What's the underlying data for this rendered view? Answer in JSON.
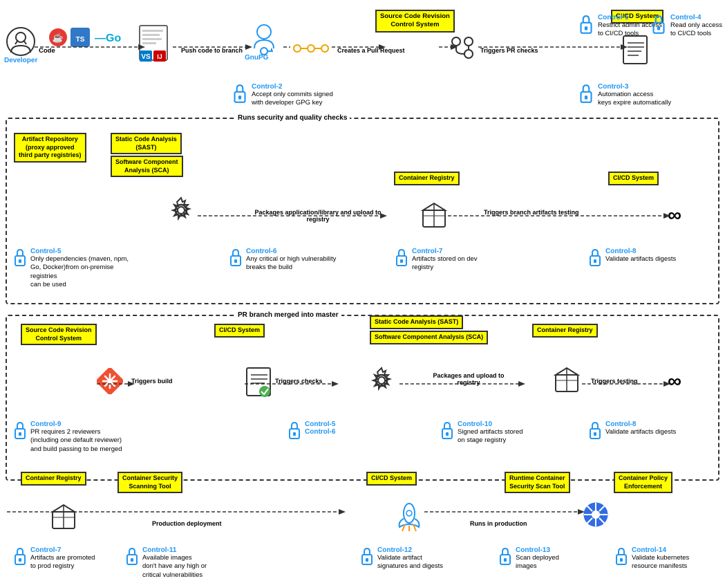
{
  "sections": {
    "section1_label": "Runs security and quality checks",
    "section2_label": "PR branch merged into master",
    "section3_label": ""
  },
  "row1": {
    "developer_label": "Developer",
    "flow1": "Code",
    "flow2": "Push code to branch",
    "flow3": "Creates a Pull Request",
    "flow4": "Triggers PR checks",
    "source_code_box": "Source Code Revision\nControl System",
    "cicd_box": "CI/CD System",
    "control1_title": "Control-1",
    "control1_text": "Restrict admin access\nto CI/CD tools",
    "control4_title": "Control-4",
    "control4_text": "Read only access\nto CI/CD tools",
    "control2_title": "Control-2",
    "control2_text": "Accept only commits signed\nwith developer GPG key",
    "control3_title": "Control-3",
    "control3_text": "Automation access\nkeys expire automatically"
  },
  "row2": {
    "artifact_repo_box": "Artifact Repository\n(proxy approved\nthird party registries)",
    "sast_box": "Static Code Analysis\n(SAST)",
    "sca_box": "Software Component\nAnalysis (SCA)",
    "container_registry_box": "Container Registry",
    "cicd_system_box": "CI/CD System",
    "flow1": "Packages application/library\nand upload to registry",
    "flow2": "Triggers branch artifacts testing",
    "control5_title": "Control-5",
    "control5_text": "Only dependencies (maven, npm,\nGo, Docker)from on-premise registries\ncan be used",
    "control6_title": "Control-6",
    "control6_text": "Any critical or high vulnerability\nbreaks the build",
    "control7_title": "Control-7",
    "control7_text": "Artifacts stored on dev\nregistry",
    "control8_title": "Control-8",
    "control8_text": "Validate artifacts digests"
  },
  "row3": {
    "source_code_box": "Source Code Revision\nControl System",
    "cicd_box": "CI/CD System",
    "sast_box": "Static Code Analysis\n(SAST)",
    "sca_box": "Software Component\nAnalysis (SCA)",
    "container_registry_box": "Container Registry",
    "flow1": "Triggers build",
    "flow2": "Triggers checks",
    "flow3": "Packages and\nupload to registry",
    "flow4": "Triggers testing",
    "control9_title": "Control-9",
    "control9_text": "PR requires 2 reviewers\n(including one default reviewer)\nand build passing to be merged",
    "control5_title": "Control-5",
    "control6_title": "Control-6",
    "control10_title": "Control-10",
    "control10_text": "Signed artifacts stored\non stage registry",
    "control8_title": "Control-8",
    "control8_text": "Validate artifacts digests"
  },
  "row4": {
    "container_registry_box": "Container Registry",
    "scanning_tool_box": "Container Security\nScanning Tool",
    "cicd_box": "CI/CD System",
    "runtime_scan_box": "Runtime Container\nSecurity Scan Tool",
    "enforcement_box": "Container Policy\nEnforcement",
    "flow1": "Production deployment",
    "flow2": "Runs in production",
    "control7_title": "Control-7",
    "control7_text": "Artifacts are promoted\nto prod registry",
    "control11_title": "Control-11",
    "control11_text": "Available images\ndon't have any high or\ncritical vulnerabilities",
    "control12_title": "Control-12",
    "control12_text": "Validate artifact\nsignatures and digests",
    "control13_title": "Control-13",
    "control13_text": "Scan deployed\nimages",
    "control14_title": "Control-14",
    "control14_text": "Validate kubernetes\nresource manifests"
  }
}
